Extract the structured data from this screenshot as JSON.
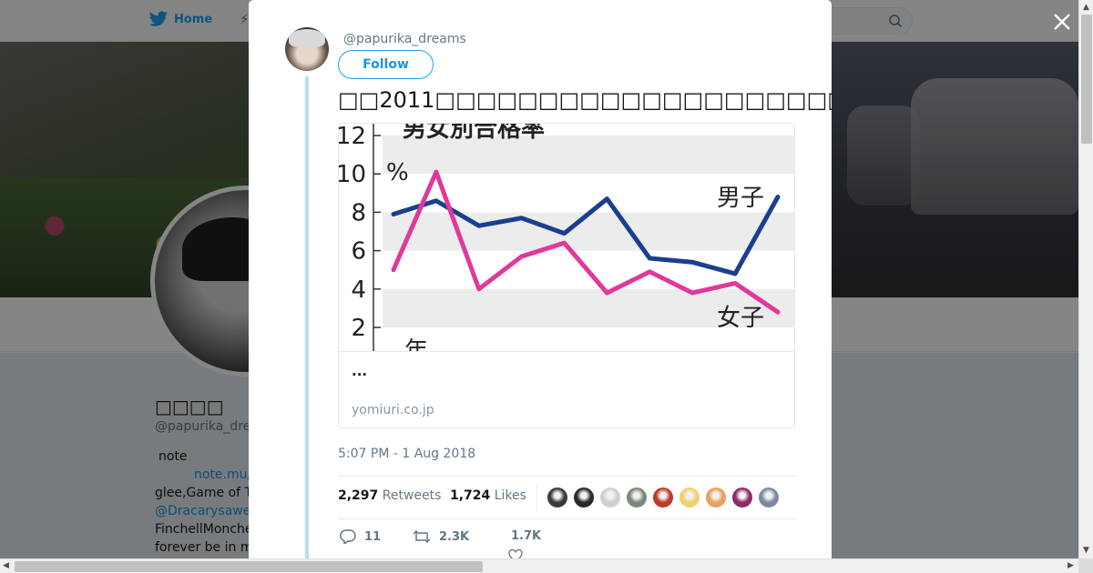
{
  "nav": {
    "home_label": "Home"
  },
  "profile": {
    "name": "□□□□",
    "handle": "@papurika_dre",
    "bio_lines": [
      "note",
      "note.mu/",
      "glee,Game of T",
      "@Dracarysawe",
      "FinchellMonche",
      "forever be in m"
    ]
  },
  "tweet": {
    "handle": "@papurika_dreams",
    "follow_label": "Follow",
    "text": "□□2011□□□□□□□□□□□□□□□□□□□□□□□□□□□□□□□□□□□□□□□□",
    "card": {
      "description": "...",
      "domain": "yomiuri.co.jp"
    },
    "timestamp": "5:07 PM - 1 Aug 2018",
    "retweets_count": "2,297",
    "retweets_label": "Retweets",
    "likes_count": "1,724",
    "likes_label": "Likes",
    "reply_count": "11",
    "retweet_action_count": "2.3K",
    "like_action_count": "1.7K"
  },
  "likers_colors": [
    "#3b3b3b",
    "#2a2a2a",
    "#d0d0d0",
    "#7a8a78",
    "#c0392b",
    "#f0d070",
    "#e8a060",
    "#8e2a6a",
    "#7c8aa0"
  ],
  "colors": {
    "twitter_blue": "#1da1f2",
    "chart_male": "#1a3f8f",
    "chart_female": "#e0399a"
  },
  "chart_data": {
    "type": "line",
    "title": "男女別合格率",
    "ylabel": "%",
    "xlabel": "年",
    "ylim": [
      0,
      12
    ],
    "yticks": [
      2,
      4,
      6,
      8,
      10,
      12
    ],
    "x": [
      1,
      2,
      3,
      4,
      5,
      6,
      7,
      8,
      9,
      10
    ],
    "series": [
      {
        "name": "男子",
        "values": [
          7.9,
          8.6,
          7.3,
          7.7,
          6.9,
          8.7,
          5.6,
          5.4,
          4.8,
          8.8
        ]
      },
      {
        "name": "女子",
        "values": [
          5.0,
          10.1,
          4.0,
          5.7,
          6.4,
          3.8,
          4.9,
          3.8,
          4.3,
          2.8
        ]
      }
    ]
  }
}
